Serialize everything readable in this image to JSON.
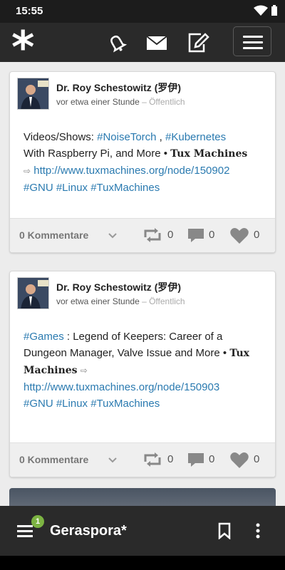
{
  "status_bar": {
    "time": "15:55"
  },
  "top_bar": {
    "logo": "*"
  },
  "posts": [
    {
      "author": "Dr. Roy Schestowitz (罗伊)",
      "time": "vor etwa einer Stunde",
      "visibility": "– Öffentlich",
      "line1_tag1": "#NoiseTorch",
      "line1_sep": " , ",
      "line1_tag2": "#Kubernetes",
      "line1_prefix": "Videos/Shows: ",
      "line2_text": "With Raspberry Pi, and More • ",
      "line2_gothic": "Tux Machines",
      "arrow": "⇨",
      "url": "http://www.tuxmachines.org/node/150902",
      "tags": "#GNU #Linux #TuxMachines",
      "comments_label": "0 Kommentare",
      "reshares": "0",
      "comment_count": "0",
      "likes": "0"
    },
    {
      "author": "Dr. Roy Schestowitz (罗伊)",
      "time": "vor etwa einer Stunde",
      "visibility": "– Öffentlich",
      "line1_tag": "#Games",
      "line1_text": " : Legend of Keepers: Career of a",
      "line2_text": "Dungeon Manager, Valve Issue and More • ",
      "line2_gothic": "Tux",
      "line3_gothic": "Machines",
      "arrow": "⇨",
      "url": "http://www.tuxmachines.org/node/150903",
      "tags": "#GNU #Linux #TuxMachines",
      "comments_label": "0 Kommentare",
      "reshares": "0",
      "comment_count": "0",
      "likes": "0"
    }
  ],
  "bottom_bar": {
    "badge": "1",
    "title": "Geraspora*"
  },
  "colors": {
    "accent": "#2a7ab0",
    "badge": "#7cb342",
    "bar": "#2a2a2a"
  }
}
